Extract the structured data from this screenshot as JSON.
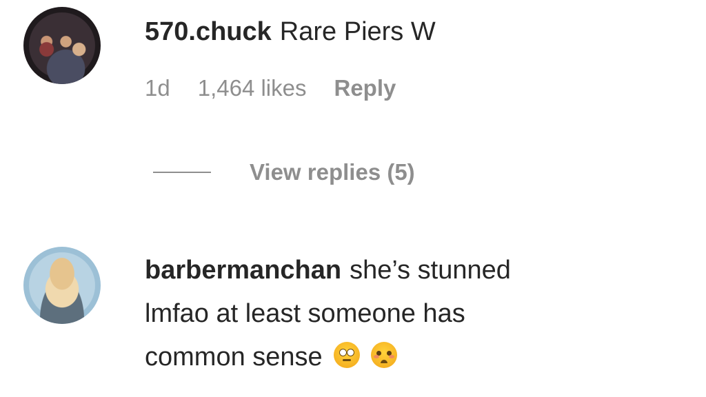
{
  "comments": [
    {
      "username": "570.chuck",
      "text": "Rare Piers W",
      "avatar_icon": "user-avatar",
      "age": "1d",
      "likes": "1,464 likes",
      "reply_label": "Reply",
      "view_replies": "View replies (5)"
    },
    {
      "username": "barbermanchan",
      "text_line1": "she’s stunned",
      "text_line2": "lmfao at least someone has",
      "text_line3": "common sense",
      "avatar_icon": "user-avatar",
      "emojis": [
        "face-with-rolling-eyes-icon",
        "pleading-face-icon"
      ]
    }
  ],
  "colors": {
    "text": "#262626",
    "secondary": "#8e8e8e",
    "background": "#ffffff"
  }
}
